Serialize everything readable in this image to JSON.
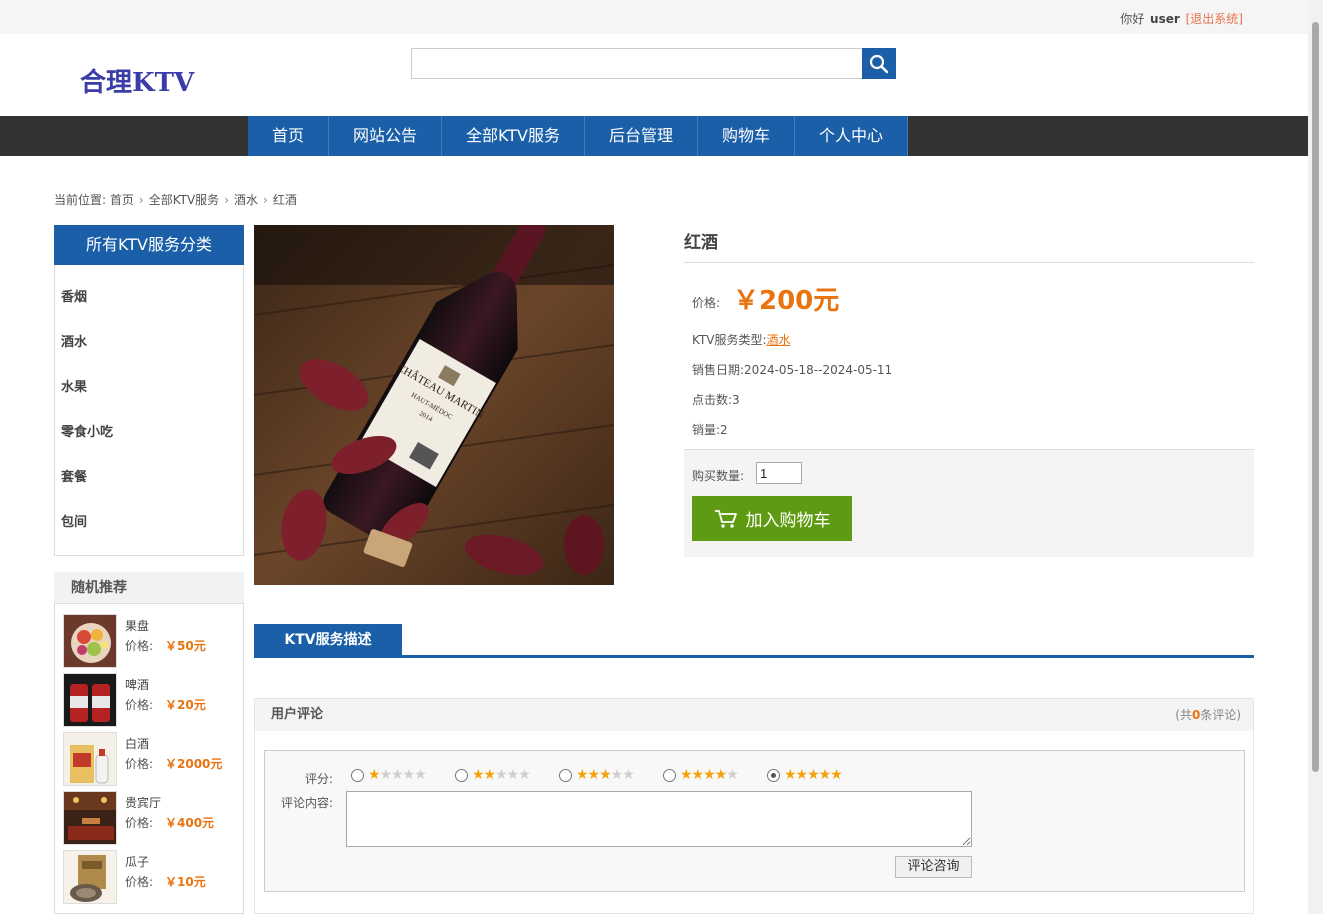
{
  "topbar": {
    "greeting": "你好",
    "username": "user",
    "logout": "[退出系统]"
  },
  "logo": "合理KTV",
  "search": {
    "placeholder": "",
    "icon": "search-icon"
  },
  "nav": [
    "首页",
    "网站公告",
    "全部KTV服务",
    "后台管理",
    "购物车",
    "个人中心"
  ],
  "breadcrumb": {
    "prefix": "当前位置:",
    "items": [
      "首页",
      "全部KTV服务",
      "酒水",
      "红酒"
    ]
  },
  "categories": {
    "title": "所有KTV服务分类",
    "items": [
      "香烟",
      "酒水",
      "水果",
      "零食小吃",
      "套餐",
      "包间"
    ]
  },
  "recommend": {
    "title": "随机推荐",
    "price_label": "价格:",
    "items": [
      {
        "name": "果盘",
        "price": "￥50元"
      },
      {
        "name": "啤酒",
        "price": "￥20元"
      },
      {
        "name": "白酒",
        "price": "￥2000元"
      },
      {
        "name": "贵宾厅",
        "price": "￥400元"
      },
      {
        "name": "瓜子",
        "price": "￥10元"
      }
    ]
  },
  "product": {
    "name": "红酒",
    "price_label": "价格:",
    "price": "￥200元",
    "type_label": "KTV服务类型:",
    "type": "酒水",
    "date_label": "销售日期:",
    "date": "2024-05-18--2024-05-11",
    "clicks_label": "点击数:",
    "clicks": "3",
    "sales_label": "销量:",
    "sales": "2",
    "qty_label": "购买数量:",
    "qty": "1",
    "cart_button": "加入购物车",
    "bottle_label": "CHÂTEAU MARTIN",
    "bottle_sub": "HAUT-MÉDOC",
    "bottle_year": "2014"
  },
  "tab": {
    "label": "KTV服务描述"
  },
  "comments": {
    "title": "用户评论",
    "count_prefix": "(共",
    "count": "0",
    "count_suffix": "条评论)",
    "rate_label": "评分:",
    "content_label": "评论内容:",
    "submit": "评论咨询",
    "selected_rating": 5
  },
  "colors": {
    "primary": "#1a5fa8",
    "accent": "#e8730f",
    "cart": "#5f9b12",
    "nav_bg": "#333333"
  }
}
